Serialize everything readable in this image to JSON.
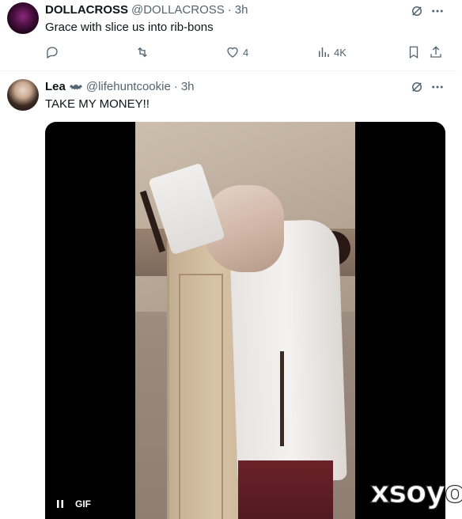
{
  "tweets": [
    {
      "name": "DOLLACROSS",
      "handle": "@DOLLACROSS",
      "separator": "·",
      "time": "3h",
      "text": "Grace with slice us into rib-bons",
      "actions": {
        "reply_count": "",
        "retweet_count": "",
        "like_count": "4",
        "views_count": "4K"
      }
    },
    {
      "name": "Lea",
      "handle": "@lifehuntcookie",
      "separator": "·",
      "time": "3h",
      "text": "TAKE MY MONEY!!",
      "media": {
        "type": "GIF",
        "label": "GIF",
        "state": "paused-control"
      }
    }
  ],
  "watermark": "xsoyo",
  "colors": {
    "text": "#0f1419",
    "secondary": "#536471",
    "divider": "#eff3f4"
  },
  "icons": [
    "grok-icon",
    "more-icon",
    "reply-icon",
    "retweet-icon",
    "like-icon",
    "views-icon",
    "bookmark-icon",
    "share-icon",
    "pause-icon"
  ]
}
